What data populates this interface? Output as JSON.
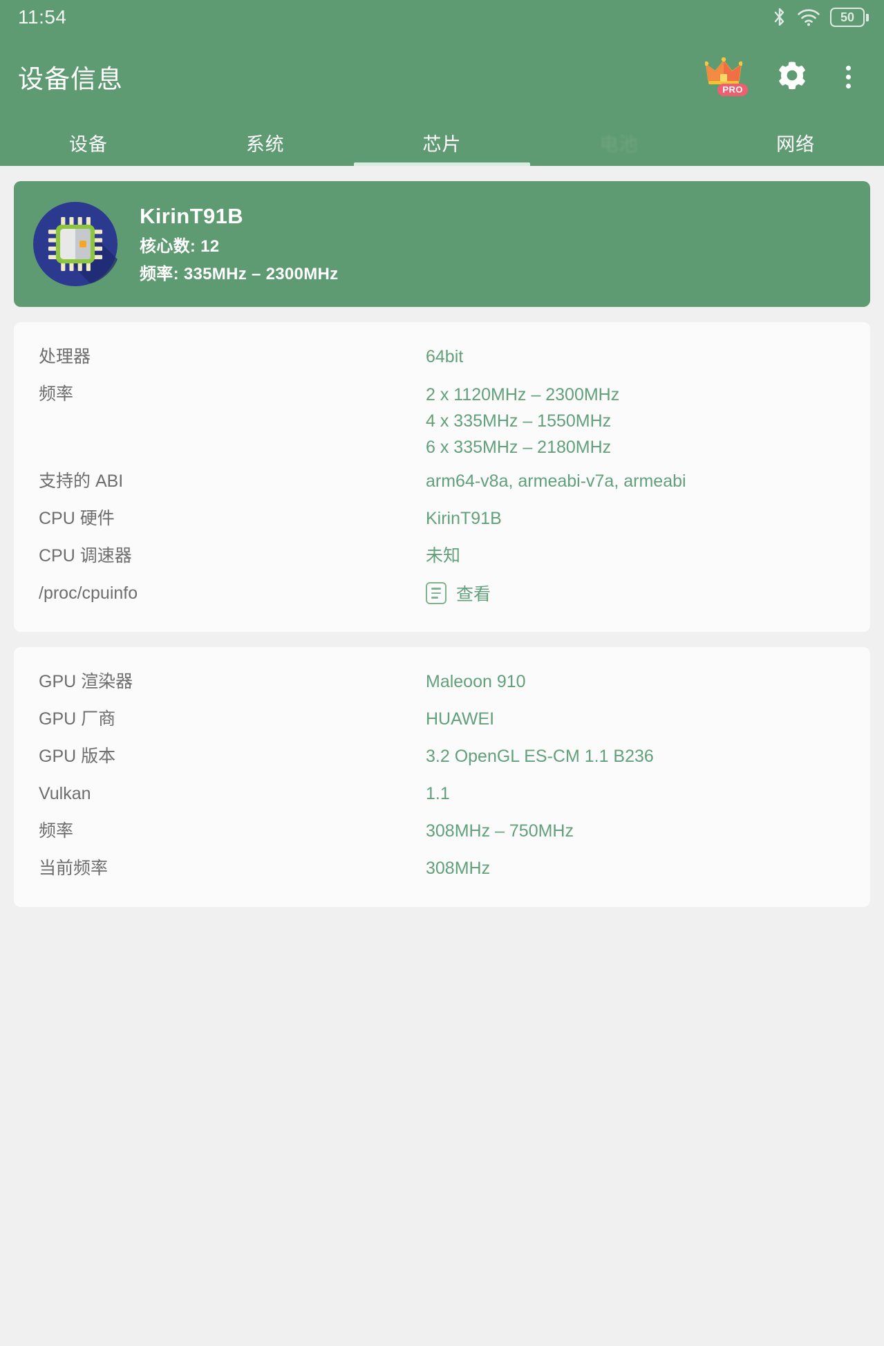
{
  "status_bar": {
    "clock": "11:54",
    "battery_level": "50",
    "icons": [
      "bluetooth-icon",
      "wifi-icon",
      "battery-icon"
    ]
  },
  "app_bar": {
    "title": "设备信息",
    "pro_badge_label": "PRO",
    "actions": [
      "pro-crown-icon",
      "settings-gear-icon",
      "overflow-menu-icon"
    ]
  },
  "tabs": {
    "items": [
      {
        "label": "设备",
        "selected": false,
        "faded": false
      },
      {
        "label": "系统",
        "selected": false,
        "faded": false
      },
      {
        "label": "芯片",
        "selected": true,
        "faded": false
      },
      {
        "label": "电池",
        "selected": false,
        "faded": true
      },
      {
        "label": "网络",
        "selected": false,
        "faded": false
      }
    ]
  },
  "hero": {
    "chip_name": "KirinT91B",
    "cores_line": "核心数: 12",
    "freq_line": "频率: 335MHz – 2300MHz"
  },
  "cpu_card": {
    "rows": [
      {
        "label": "处理器",
        "value": "64bit"
      },
      {
        "label": "频率",
        "value": "2 x 1120MHz – 2300MHz\n4 x 335MHz – 1550MHz\n6 x 335MHz – 2180MHz"
      },
      {
        "label": "支持的 ABI",
        "value": "arm64-v8a, armeabi-v7a, armeabi"
      },
      {
        "label": "CPU 硬件",
        "value": "KirinT91B"
      },
      {
        "label": "CPU 调速器",
        "value": "未知"
      }
    ],
    "cpuinfo_row": {
      "label": "/proc/cpuinfo",
      "action_label": "查看"
    }
  },
  "gpu_card": {
    "rows": [
      {
        "label": "GPU 渲染器",
        "value": "Maleoon 910"
      },
      {
        "label": "GPU 厂商",
        "value": "HUAWEI"
      },
      {
        "label": "GPU 版本",
        "value": "3.2 OpenGL ES-CM 1.1 B236"
      },
      {
        "label": "Vulkan",
        "value": "1.1"
      },
      {
        "label": "频率",
        "value": "308MHz – 750MHz"
      },
      {
        "label": "当前频率",
        "value": "308MHz"
      }
    ]
  },
  "colors": {
    "brand_green": "#5f9b72",
    "value_green": "#62a07b",
    "page_bg": "#f0f0f0",
    "card_bg": "#fbfbfb",
    "label_gray": "#6d6d6d",
    "pro_badge": "#ef5f72"
  }
}
